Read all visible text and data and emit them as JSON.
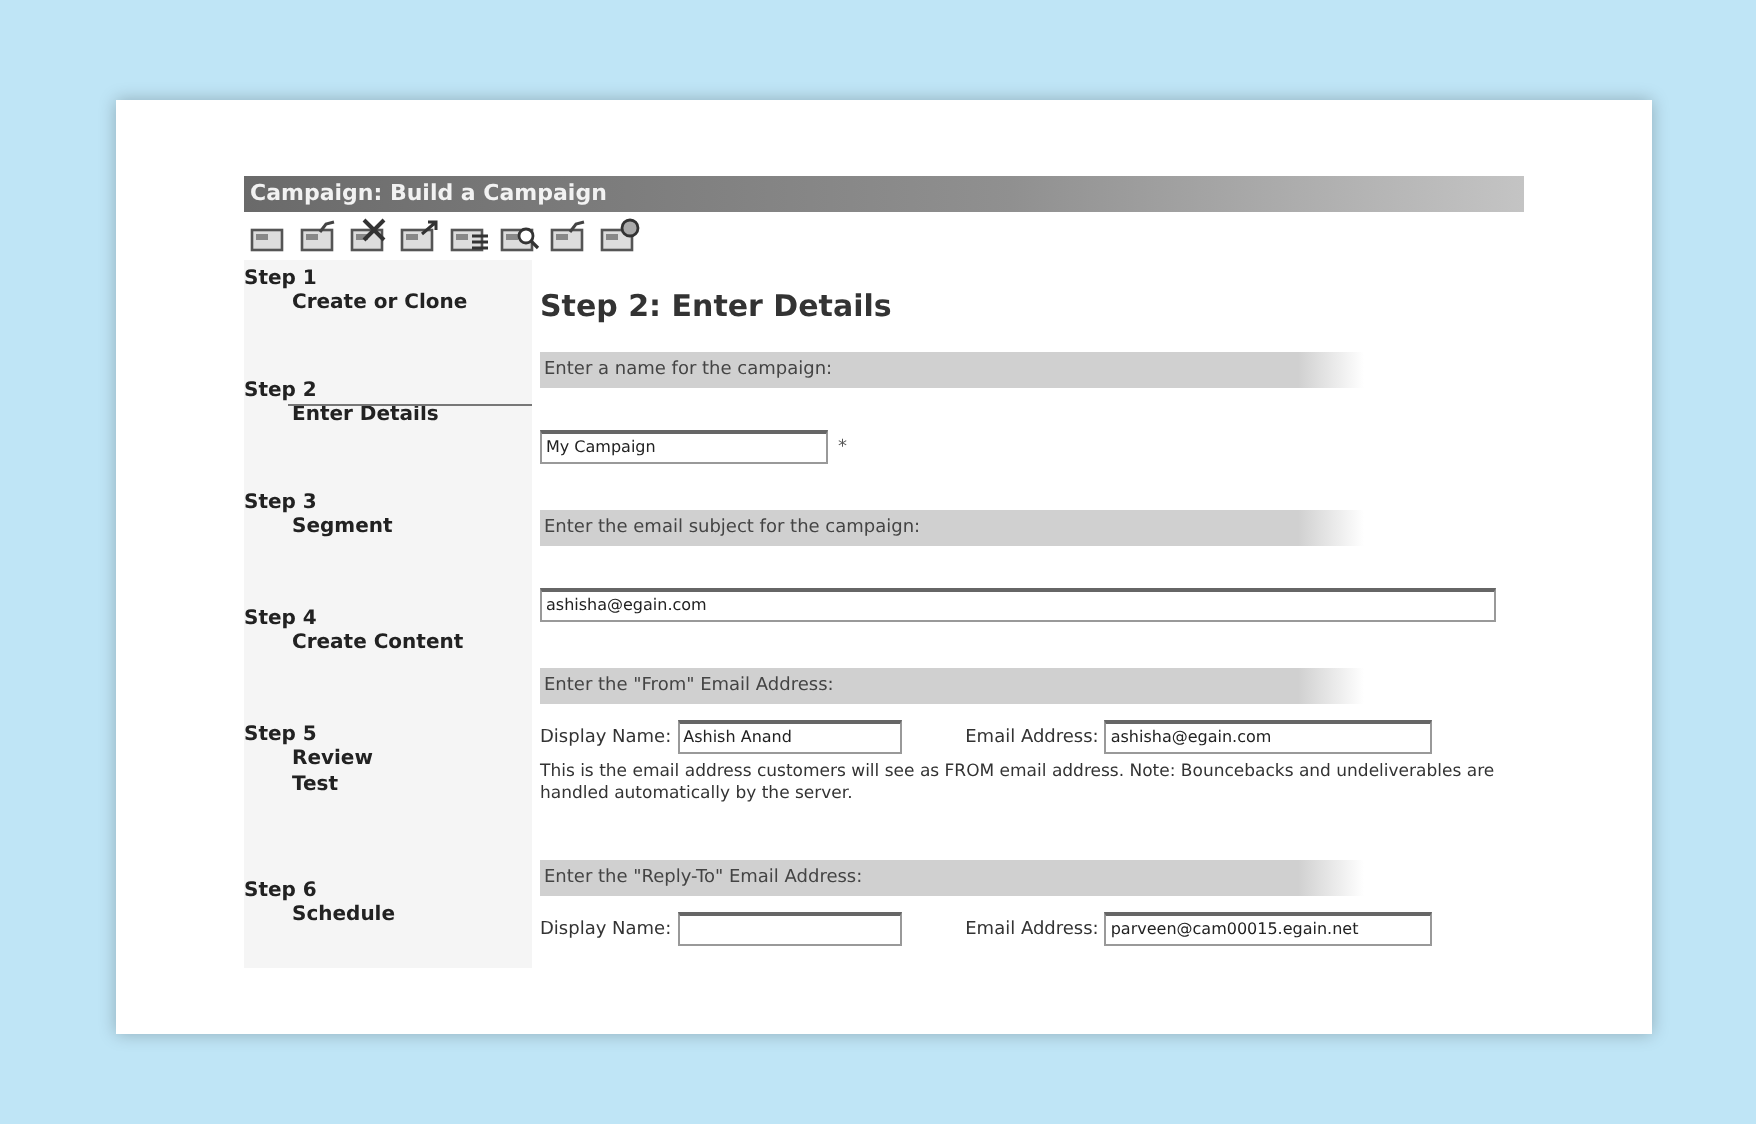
{
  "window": {
    "title": "Campaign: Build a Campaign"
  },
  "toolbar": {
    "icons": [
      {
        "kind": "plain"
      },
      {
        "kind": "check"
      },
      {
        "kind": "cross"
      },
      {
        "kind": "arrow"
      },
      {
        "kind": "list"
      },
      {
        "kind": "magnifier"
      },
      {
        "kind": "check"
      },
      {
        "kind": "gear"
      }
    ]
  },
  "steps": [
    {
      "number": "Step 1",
      "labels": [
        "Create or Clone"
      ],
      "selected": false
    },
    {
      "number": "Step 2",
      "labels": [
        "Enter Details"
      ],
      "selected": true
    },
    {
      "number": "Step 3",
      "labels": [
        "Segment"
      ],
      "selected": false
    },
    {
      "number": "Step 4",
      "labels": [
        "Create Content"
      ],
      "selected": false
    },
    {
      "number": "Step 5",
      "labels": [
        "Review",
        "Test"
      ],
      "selected": false
    },
    {
      "number": "Step 6",
      "labels": [
        "Schedule"
      ],
      "selected": false
    }
  ],
  "heading": "Step 2: Enter Details",
  "sections": [
    {
      "kind": "single",
      "title": "Enter a name for the campaign:",
      "value": "My Campaign",
      "required_mark": "*",
      "wide": false
    },
    {
      "kind": "single",
      "title": "Enter the email subject for the campaign:",
      "value": "ashisha@egain.com",
      "wide": true
    },
    {
      "kind": "pair",
      "title": "Enter the \"From\" Email Address:",
      "name_label": "Display Name:",
      "name_value": "Ashish Anand",
      "email_label": "Email Address:",
      "email_value": "ashisha@egain.com",
      "note": "This is the email address customers will see as FROM email address. Note: Bouncebacks and undeliverables are handled automatically by the server."
    },
    {
      "kind": "pair",
      "title": "Enter the \"Reply-To\" Email Address:",
      "name_label": "Display Name:",
      "email_label": "Email Address:",
      "email_value": "parveen@cam00015.egain.net"
    }
  ]
}
